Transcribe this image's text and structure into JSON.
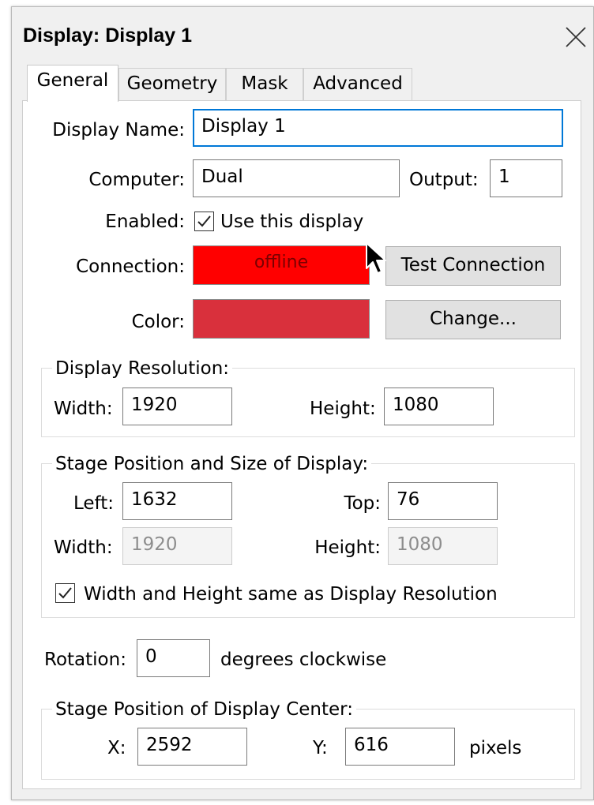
{
  "window": {
    "title": "Display: Display 1"
  },
  "tabs": [
    "General",
    "Geometry",
    "Mask",
    "Advanced"
  ],
  "general": {
    "display_name_label": "Display Name:",
    "display_name_value": "Display 1",
    "computer_label": "Computer:",
    "computer_value": "Dual",
    "output_label": "Output:",
    "output_value": "1",
    "enabled_label": "Enabled:",
    "enabled_checkbox_label": "Use this display",
    "enabled_checked": true,
    "connection_label": "Connection:",
    "connection_status": "offline",
    "test_connection_button": "Test Connection",
    "color_label": "Color:",
    "change_button": "Change..."
  },
  "display_resolution": {
    "legend": "Display Resolution:",
    "width_label": "Width:",
    "width_value": "1920",
    "height_label": "Height:",
    "height_value": "1080"
  },
  "stage_position_size": {
    "legend": "Stage Position and Size of Display:",
    "left_label": "Left:",
    "left_value": "1632",
    "top_label": "Top:",
    "top_value": "76",
    "width_label": "Width:",
    "width_value": "1920",
    "height_label": "Height:",
    "height_value": "1080",
    "same_as_resolution_label": "Width and Height same as Display Resolution",
    "same_as_resolution_checked": true
  },
  "rotation": {
    "label": "Rotation:",
    "value": "0",
    "unit": "degrees clockwise"
  },
  "display_center": {
    "legend": "Stage Position of Display Center:",
    "x_label": "X:",
    "x_value": "2592",
    "y_label": "Y:",
    "y_value": "616",
    "unit": "pixels"
  },
  "colors": {
    "connection_offline": "#ff0000",
    "connection_text": "#8b0000",
    "display_color": "#d9303c",
    "focus_border": "#0078d7"
  },
  "icons": {
    "close": "close-icon",
    "check": "checkmark-icon",
    "cursor": "mouse-pointer-icon"
  }
}
